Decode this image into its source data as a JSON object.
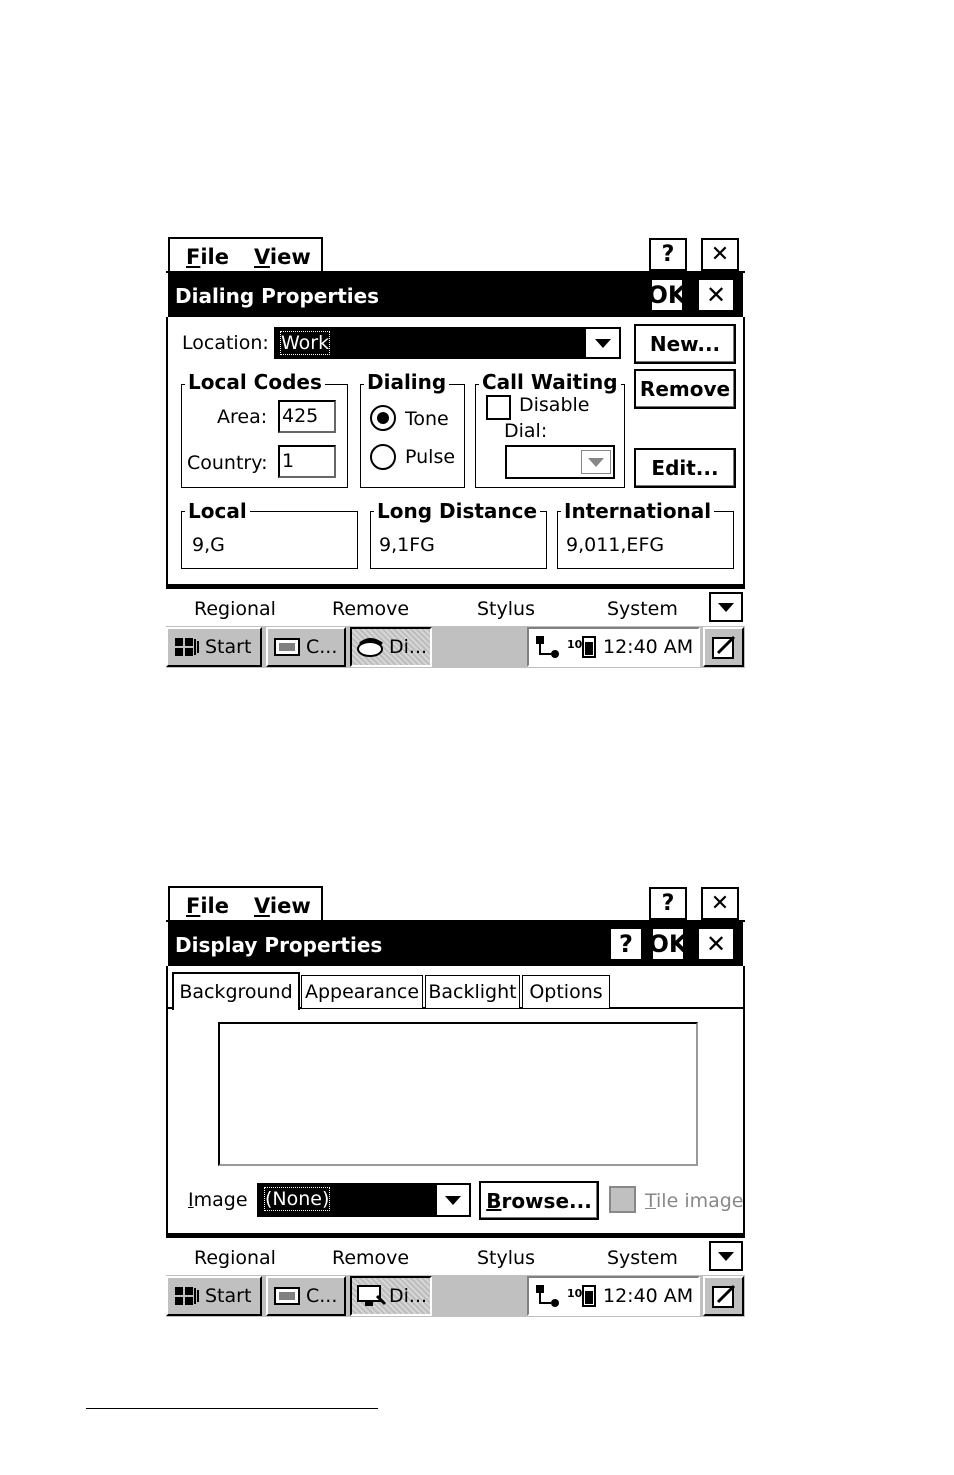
{
  "dialing": {
    "menu": {
      "file": "File",
      "file_key": "F",
      "file_rest": "ile",
      "view": "View",
      "view_key": "V",
      "view_rest": "iew"
    },
    "top_buttons": {
      "help": "?",
      "close": "✕"
    },
    "title": "Dialing Properties",
    "ok": "OK",
    "close": "✕",
    "location_label": "Location:",
    "location_value": "Work",
    "new_button": "New...",
    "remove_button": "Remove",
    "edit_button": "Edit...",
    "local_codes": {
      "title": "Local Codes",
      "area_label": "Area:",
      "area_value": "425",
      "country_label": "Country:",
      "country_value": "1"
    },
    "dialing_group": {
      "title": "Dialing",
      "tone": "Tone",
      "pulse": "Pulse",
      "selected": "Tone"
    },
    "call_waiting": {
      "title": "Call Waiting",
      "disable_label": "Disable",
      "disable_checked": false,
      "dial_label": "Dial:"
    },
    "local": {
      "title": "Local",
      "value": "9,G"
    },
    "long_distance": {
      "title": "Long Distance",
      "value": "9,1FG"
    },
    "international": {
      "title": "International",
      "value": "9,011,EFG"
    }
  },
  "display": {
    "menu": {
      "file_key": "F",
      "file_rest": "ile",
      "view_key": "V",
      "view_rest": "iew"
    },
    "top_buttons": {
      "help": "?",
      "close": "✕"
    },
    "title": "Display Properties",
    "help": "?",
    "ok": "OK",
    "close": "✕",
    "tabs": [
      "Background",
      "Appearance",
      "Backlight",
      "Options"
    ],
    "active_tab": "Background",
    "image_label_key": "I",
    "image_label_rest": "mage",
    "image_value": "(None)",
    "browse_key": "B",
    "browse_rest": "rowse...",
    "tile_key": "T",
    "tile_rest": "ile image",
    "tile_checked": false
  },
  "sip_bar": {
    "items": [
      "Regional",
      "Remove",
      "Stylus",
      "System"
    ]
  },
  "taskbar": {
    "start": "Start",
    "task1": "C...",
    "task2": "Di...",
    "clock": "12:40 AM"
  }
}
